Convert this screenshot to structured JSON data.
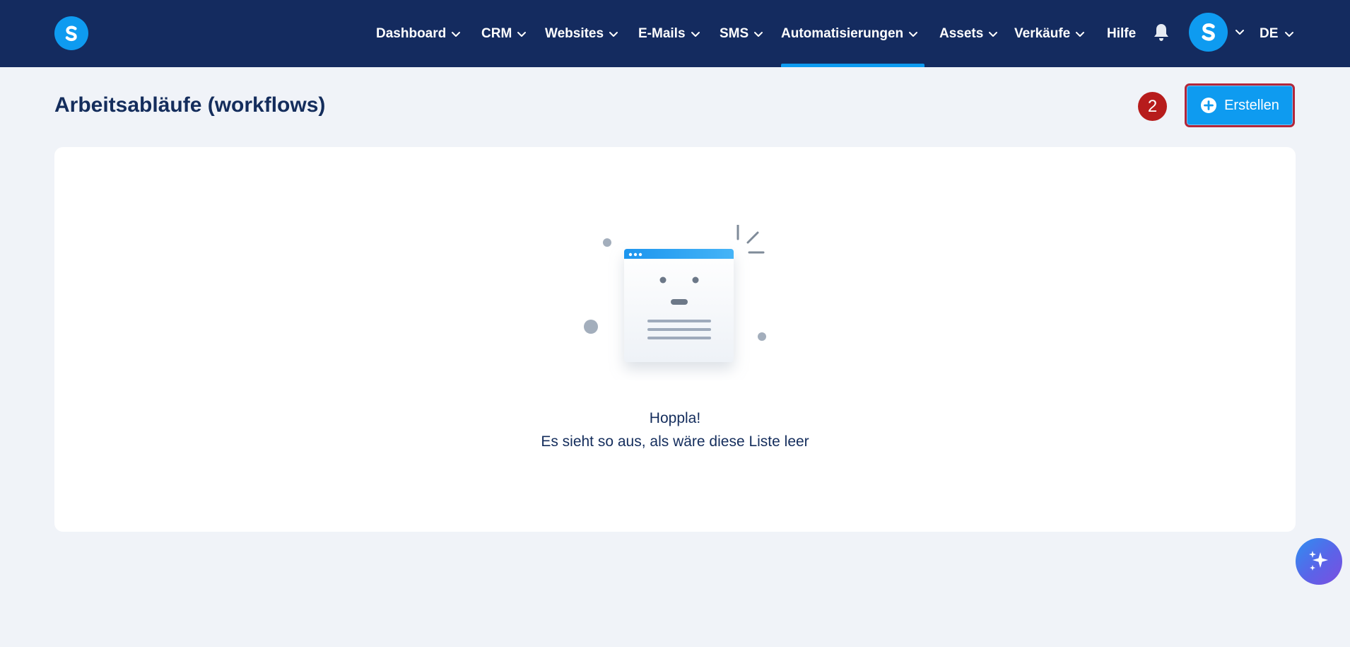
{
  "nav": {
    "items": [
      {
        "label": "Dashboard",
        "dropdown": true
      },
      {
        "label": "CRM",
        "dropdown": true
      },
      {
        "label": "Websites",
        "dropdown": true
      },
      {
        "label": "E-Mails",
        "dropdown": true
      },
      {
        "label": "SMS",
        "dropdown": true
      },
      {
        "label": "Automatisierungen",
        "dropdown": true,
        "active": true
      },
      {
        "label": "Assets",
        "dropdown": true
      },
      {
        "label": "Verkäufe",
        "dropdown": true
      },
      {
        "label": "Hilfe",
        "dropdown": false
      }
    ],
    "language": "DE",
    "icons": {
      "logo": "s-logo-icon",
      "notifications": "bell-icon",
      "avatar": "s-avatar-icon"
    }
  },
  "page": {
    "title": "Arbeitsabläufe (workflows)",
    "step_badge": "2",
    "create_label": "Erstellen"
  },
  "empty_state": {
    "title": "Hoppla!",
    "subtitle": "Es sieht so aus, als wäre diese Liste leer"
  },
  "colors": {
    "topbar": "#142b5f",
    "accent": "#0e9bf0",
    "badge": "#b71c1c",
    "background": "#f0f3f8"
  }
}
